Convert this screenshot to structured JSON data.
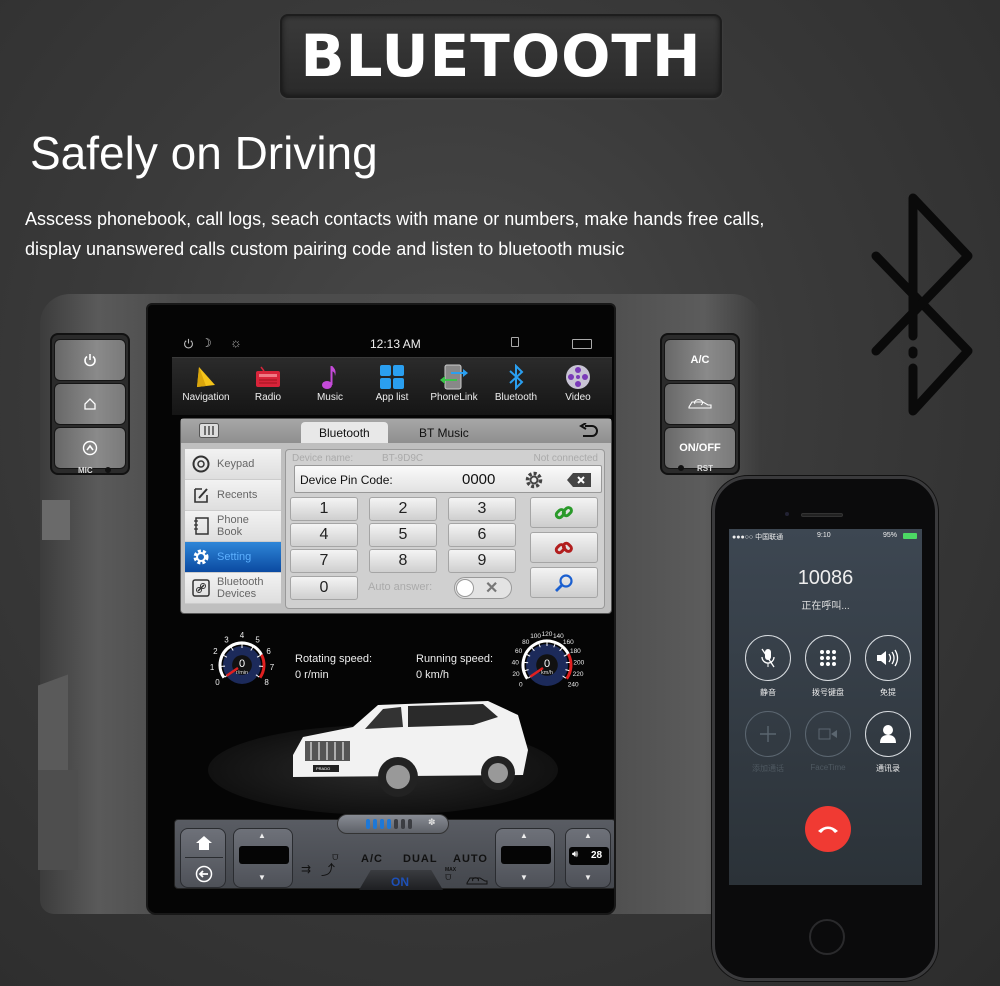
{
  "banner": {
    "title": "BLUETOOTH",
    "subtitle": "Safely on Driving",
    "description_line1": "Asscess phonebook, call logs, seach contacts with mane or numbers, make hands free calls,",
    "description_line2": "display unanswered calls custom pairing code and listen to bluetooth music"
  },
  "head_unit": {
    "left_buttons": [
      {
        "icon": "power-icon"
      },
      {
        "icon": "home-icon"
      },
      {
        "icon": "eject-icon"
      }
    ],
    "mic_label": "MIC",
    "right_buttons": [
      {
        "label": "A/C"
      },
      {
        "icon": "car-recirculation-icon"
      },
      {
        "label": "ON/OFF"
      }
    ],
    "rst_label": "RST",
    "status_bar": {
      "time": "12:13 AM",
      "icons": [
        "power-icon",
        "night-mode-icon",
        "brightness-icon",
        "usb-icon",
        "multiwindow-icon"
      ]
    },
    "apps": [
      {
        "label": "Navigation",
        "icon": "navigation-icon"
      },
      {
        "label": "Radio",
        "icon": "radio-icon"
      },
      {
        "label": "Music",
        "icon": "music-note-icon"
      },
      {
        "label": "App list",
        "icon": "app-grid-icon"
      },
      {
        "label": "PhoneLink",
        "icon": "phonelink-icon"
      },
      {
        "label": "Bluetooth",
        "icon": "bluetooth-icon"
      },
      {
        "label": "Video",
        "icon": "video-reel-icon"
      }
    ],
    "bluetooth_panel": {
      "tabs": [
        {
          "label": "Bluetooth",
          "active": true
        },
        {
          "label": "BT Music",
          "active": false
        }
      ],
      "menu": [
        {
          "label": "Keypad",
          "icon": "keypad-dial-icon",
          "selected": false
        },
        {
          "label": "Recents",
          "icon": "recents-edit-icon",
          "selected": false
        },
        {
          "label": "Phone\nBook",
          "label_line1": "Phone",
          "label_line2": "Book",
          "icon": "phonebook-icon",
          "selected": false
        },
        {
          "label": "Setting",
          "icon": "gear-icon",
          "selected": true
        },
        {
          "label_line1": "Bluetooth",
          "label_line2": "Devices",
          "icon": "link-icon",
          "selected": false
        }
      ],
      "device_name_label": "Device name:",
      "device_name": "BT-9D9C",
      "connection_status": "Not connected",
      "pin_label": "Device Pin Code:",
      "pin_value": "0000",
      "keys": [
        "1",
        "2",
        "3",
        "4",
        "5",
        "6",
        "7",
        "8",
        "9",
        "0"
      ],
      "auto_answer_label": "Auto answer:",
      "auto_answer_on": false,
      "side_actions": [
        "connect-link-icon",
        "disconnect-link-icon",
        "search-icon"
      ]
    },
    "gauges": {
      "rpm": {
        "value": "0",
        "unit": "r/min",
        "ticks": [
          "0",
          "1",
          "2",
          "3",
          "4",
          "5",
          "6",
          "7",
          "8"
        ],
        "label": "Rotating speed:",
        "readout": "0 r/min"
      },
      "speed": {
        "value": "0",
        "unit": "km/h",
        "ticks": [
          "0",
          "20",
          "40",
          "60",
          "80",
          "100",
          "120",
          "140",
          "160",
          "180",
          "200",
          "220",
          "240"
        ],
        "label": "Running speed:",
        "readout": "0 km/h"
      }
    },
    "car_badge": "PRADO",
    "climate": {
      "fan_level": 4,
      "fan_max": 7,
      "labels": {
        "ac": "A/C",
        "dual": "DUAL",
        "auto": "AUTO",
        "on": "ON",
        "max": "MAX"
      },
      "volume": "28"
    }
  },
  "phone": {
    "carrier": "●●●○○ 中国联通",
    "time": "9:10",
    "battery": "95%",
    "number": "10086",
    "call_status": "正在呼叫...",
    "buttons": [
      {
        "label": "静音",
        "icon": "mute-mic-icon",
        "enabled": true
      },
      {
        "label": "拨号键盘",
        "icon": "keypad-icon",
        "enabled": true
      },
      {
        "label": "免提",
        "icon": "speaker-icon",
        "enabled": true
      },
      {
        "label": "添加通话",
        "icon": "add-call-icon",
        "enabled": false
      },
      {
        "label": "FaceTime",
        "icon": "facetime-icon",
        "enabled": false
      },
      {
        "label": "通讯录",
        "icon": "contacts-icon",
        "enabled": true
      }
    ],
    "end_call_color": "#f03a33"
  },
  "colors": {
    "accent_blue": "#1e78d6",
    "gauge_red": "#e02020",
    "gauge_navy": "#1c2a5a"
  }
}
